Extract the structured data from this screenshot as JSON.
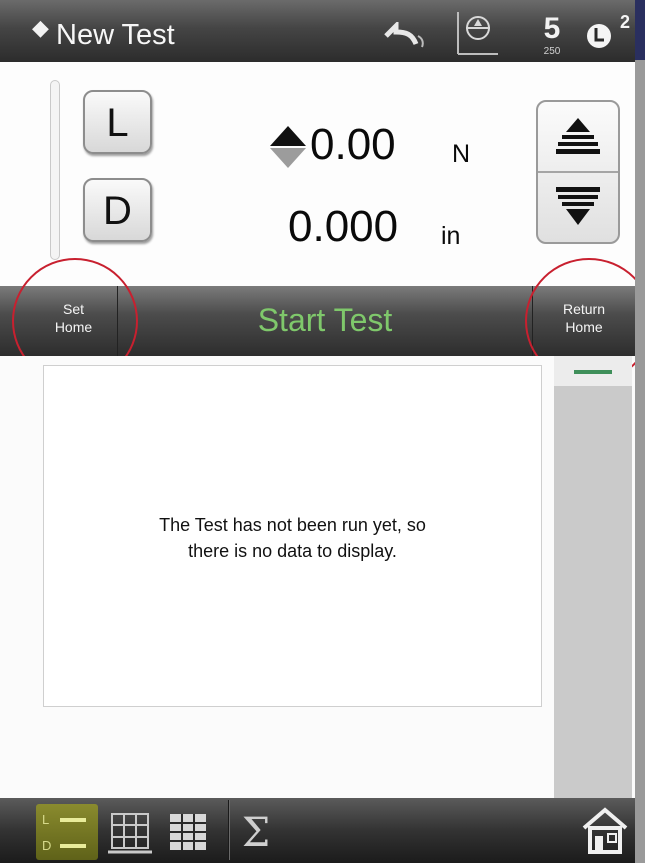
{
  "title_bar": {
    "title": "New Test",
    "icons": [
      "sort-arrows-icon",
      "undo-icon",
      "crosshead-gauge-icon",
      "speed-icon",
      "limit-icon"
    ],
    "speed_value": "250",
    "limit_count": "2"
  },
  "readout": {
    "load_key": "L",
    "load_value": "0.00",
    "load_unit": "N",
    "distance_key": "D",
    "distance_value": "0.000",
    "distance_unit": "in",
    "jog_icons": [
      "jog-up-icon",
      "jog-down-icon"
    ]
  },
  "action_bar": {
    "set_home_line1": "Set",
    "set_home_line2": "Home",
    "start_label": "Start Test",
    "return_home_line1": "Return",
    "return_home_line2": "Home",
    "start_color": "#7fc86b",
    "highlight_color": "#c8202f"
  },
  "content": {
    "message_line1": "The Test has not been run yet, so",
    "message_line2": "there is no data to display."
  },
  "bottom_bar": {
    "ld_top": "L",
    "ld_bottom": "D",
    "icons": [
      "load-distance-icon",
      "graph-icon",
      "table-icon",
      "statistics-sigma-icon",
      "home-icon"
    ],
    "sigma_label": "Σ",
    "accent_color": "#7d7e2a"
  }
}
